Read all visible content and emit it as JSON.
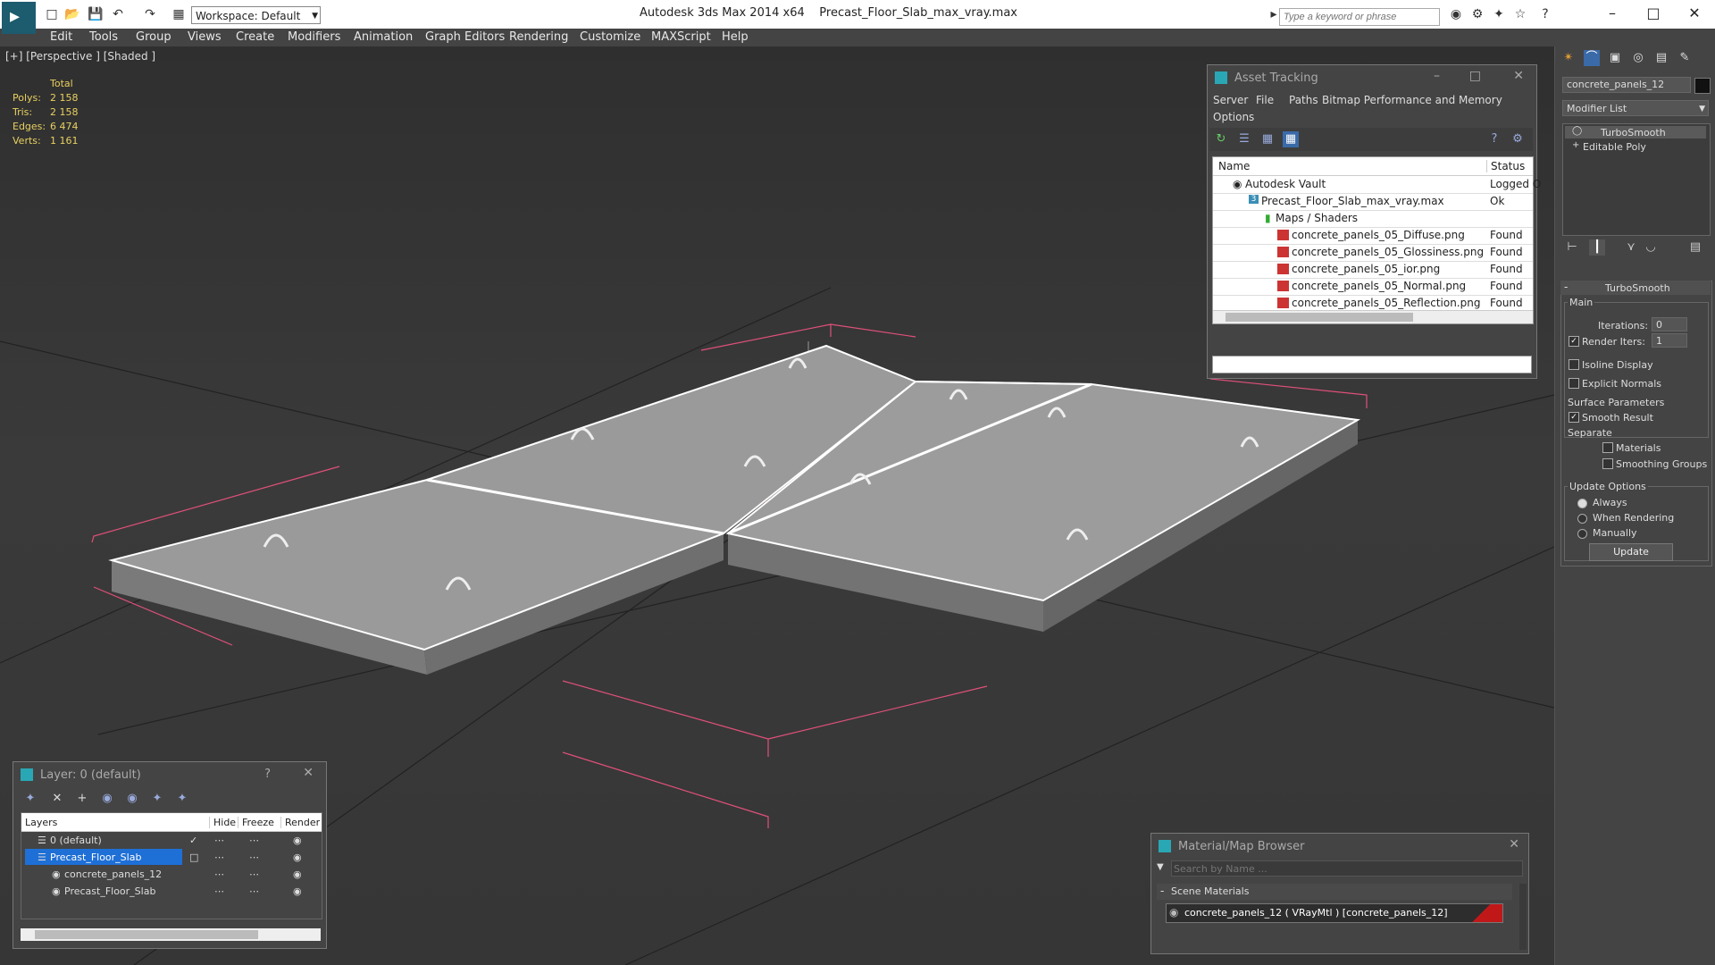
{
  "titlebar": {
    "workspace": "Workspace: Default",
    "app": "Autodesk 3ds Max  2014 x64",
    "file": "Precast_Floor_Slab_max_vray.max",
    "search_placeholder": "Type a keyword or phrase"
  },
  "menu": [
    "Edit",
    "Tools",
    "Group",
    "Views",
    "Create",
    "Modifiers",
    "Animation",
    "Graph Editors",
    "Rendering",
    "Customize",
    "MAXScript",
    "Help"
  ],
  "viewport": {
    "label": "[+] [Perspective ] [Shaded ]",
    "stats": {
      "header": "Total",
      "rows": [
        {
          "label": "Polys:",
          "value": "2 158"
        },
        {
          "label": "Tris:",
          "value": "2 158"
        },
        {
          "label": "Edges:",
          "value": "6 474"
        },
        {
          "label": "Verts:",
          "value": "1 161"
        }
      ]
    }
  },
  "asset_tracking": {
    "title": "Asset Tracking",
    "menu": [
      "Server",
      "File",
      "Paths",
      "Bitmap Performance and Memory",
      "Options"
    ],
    "columns": {
      "name": "Name",
      "status": "Status"
    },
    "rows": [
      {
        "name": "Autodesk Vault",
        "status": "Logged O",
        "indent": 0,
        "kind": "vault"
      },
      {
        "name": "Precast_Floor_Slab_max_vray.max",
        "status": "Ok",
        "indent": 1,
        "kind": "max"
      },
      {
        "name": "Maps / Shaders",
        "status": "",
        "indent": 2,
        "kind": "folder"
      },
      {
        "name": "concrete_panels_05_Diffuse.png",
        "status": "Found",
        "indent": 3,
        "kind": "png"
      },
      {
        "name": "concrete_panels_05_Glossiness.png",
        "status": "Found",
        "indent": 3,
        "kind": "png"
      },
      {
        "name": "concrete_panels_05_ior.png",
        "status": "Found",
        "indent": 3,
        "kind": "png"
      },
      {
        "name": "concrete_panels_05_Normal.png",
        "status": "Found",
        "indent": 3,
        "kind": "png"
      },
      {
        "name": "concrete_panels_05_Reflection.png",
        "status": "Found",
        "indent": 3,
        "kind": "png"
      }
    ]
  },
  "layer": {
    "title": "Layer: 0 (default)",
    "columns": {
      "layers": "Layers",
      "hide": "Hide",
      "freeze": "Freeze",
      "render": "Render"
    },
    "rows": [
      {
        "name": "0 (default)",
        "indent": 0
      },
      {
        "name": "Precast_Floor_Slab",
        "indent": 0,
        "selected": true
      },
      {
        "name": "concrete_panels_12",
        "indent": 1
      },
      {
        "name": "Precast_Floor_Slab",
        "indent": 1
      }
    ]
  },
  "material_browser": {
    "title": "Material/Map Browser",
    "search_placeholder": "Search by Name ...",
    "section": "Scene Materials",
    "item": "concrete_panels_12  ( VRayMtl )  [concrete_panels_12]",
    "accent_color": "#c01818"
  },
  "command_panel": {
    "object_name": "concrete_panels_12",
    "modifier_list": "Modifier List",
    "stack": [
      "TurboSmooth",
      "Editable Poly"
    ],
    "rollout": "TurboSmooth",
    "main": "Main",
    "iterations_label": "Iterations:",
    "iterations_value": "0",
    "render_iters_label": "Render Iters:",
    "render_iters_value": "1",
    "isoline": "Isoline Display",
    "explicit": "Explicit Normals",
    "surface_params": "Surface Parameters",
    "smooth_result": "Smooth Result",
    "separate": "Separate",
    "materials": "Materials",
    "smoothing_groups": "Smoothing Groups",
    "update_options": "Update Options",
    "always": "Always",
    "when_rendering": "When Rendering",
    "manually": "Manually",
    "update": "Update"
  }
}
